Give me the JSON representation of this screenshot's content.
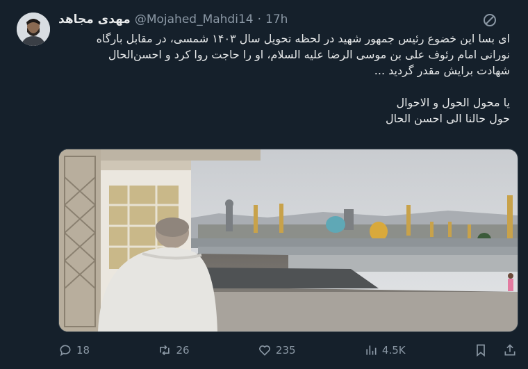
{
  "author": {
    "name": "مهدی مجاهد",
    "handle": "@Mojahed_Mahdi14",
    "separator": "·",
    "time": "17h"
  },
  "tweet": {
    "lines": [
      "ای بسا این خضوع رئیس جمهور شهید در لحظه تحویل سال ۱۴۰۳ شمسی، در مقابل بارگاه",
      "نورانی امام رئوف علی بن موسی الرضا علیه السلام، او را حاجت روا کرد و احسن‌الحال",
      "شهادت برایش مقدر گردید ...",
      "",
      "یا محول الحول و الاحوال",
      "حول حالنا الی احسن الحال"
    ]
  },
  "actions": {
    "replies": "18",
    "retweets": "26",
    "likes": "235",
    "views": "4.5K"
  },
  "icons": {
    "more": "more-icon",
    "reply": "reply-icon",
    "retweet": "retweet-icon",
    "like": "like-icon",
    "views": "views-icon",
    "bookmark": "bookmark-icon",
    "share": "share-icon"
  },
  "colors": {
    "background": "#15202b",
    "text": "#e7e9ea",
    "secondary": "#8b98a5"
  }
}
